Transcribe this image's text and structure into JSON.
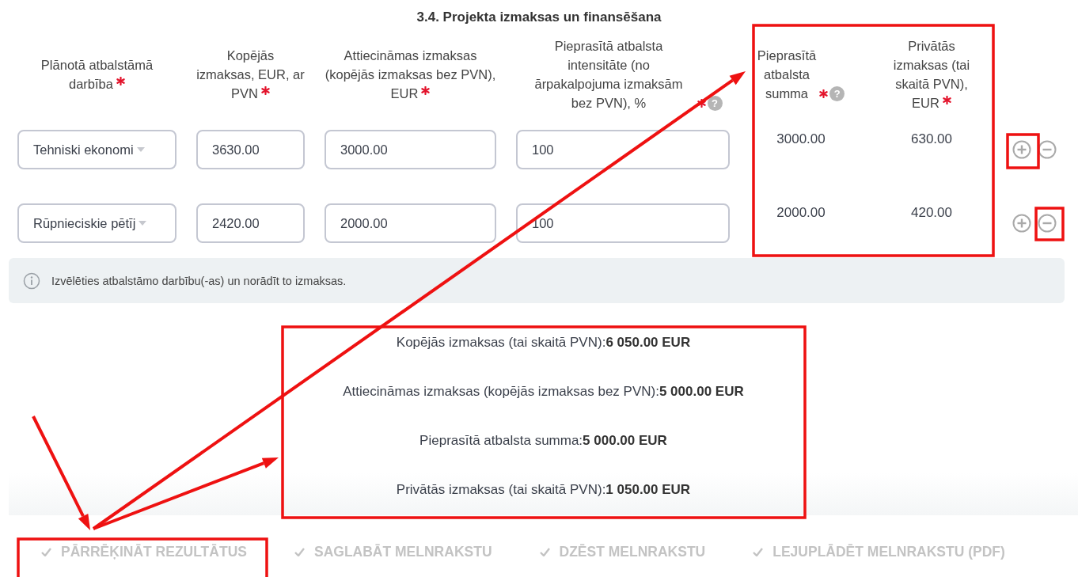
{
  "title": "3.4. Projekta izmaksas un finansēšana",
  "columns": [
    {
      "label": "Plānotā atbalstāmā darbība",
      "required": true
    },
    {
      "label": "Kopējās izmaksas, EUR, ar PVN",
      "required": true
    },
    {
      "label": "Attiecināmas izmaksas (kopējās izmaksas bez PVN), EUR",
      "required": true
    },
    {
      "label": "Pieprasītā atbalsta intensitāte (no ārpakalpojuma izmaksām bez PVN), %",
      "required": true,
      "help": "?"
    },
    {
      "label": "Pieprasītā atbalsta summa",
      "required": true,
      "help": "?"
    },
    {
      "label": "Privātās izmaksas (tai skaitā PVN), EUR",
      "required": true
    }
  ],
  "rows": [
    {
      "cells": [
        {
          "kind": "select",
          "value": "Tehniski ekonomi"
        },
        {
          "kind": "input",
          "value": "3630.00"
        },
        {
          "kind": "input",
          "value": "3000.00"
        },
        {
          "kind": "input",
          "value": "100"
        },
        {
          "kind": "value",
          "value": "3000.00"
        },
        {
          "kind": "value",
          "value": "630.00"
        }
      ]
    },
    {
      "cells": [
        {
          "kind": "select",
          "value": "Rūpnieciskie pētīj"
        },
        {
          "kind": "input",
          "value": "2420.00"
        },
        {
          "kind": "input",
          "value": "2000.00"
        },
        {
          "kind": "input",
          "value": "100"
        },
        {
          "kind": "value",
          "value": "2000.00"
        },
        {
          "kind": "value",
          "value": "420.00"
        }
      ]
    }
  ],
  "info": "Izvēlēties atbalstāmo darbību(-as) un norādīt to izmaksas.",
  "summary": [
    "Kopējās izmaksas (tai skaitā PVN):**6 050.00 EUR**",
    "Attiecināmas izmaksas (kopējās izmaksas bez PVN):**5 000.00 EUR**",
    "Pieprasītā atbalsta summa:**5 000.00 EUR**",
    "Privātās izmaksas (tai skaitā PVN):**1 050.00 EUR**"
  ],
  "actions": [
    "PĀRRĒĶINĀT REZULTĀTUS",
    "SAGLABĀT MELNRAKSTU",
    "DZĒST MELNRAKSTU",
    "LEJUPLĀDĒT MELNRAKSTU (PDF)"
  ]
}
